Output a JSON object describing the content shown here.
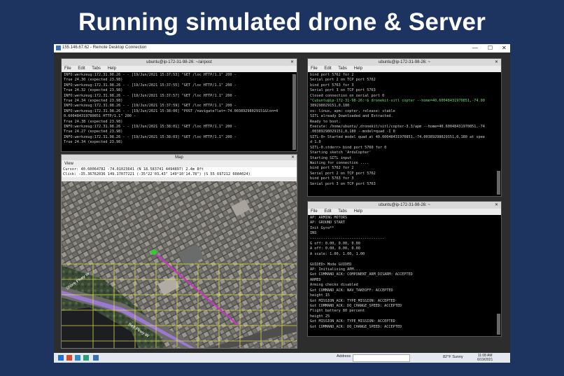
{
  "slide_title": "Running simulated drone & Server",
  "rdp": {
    "title": "155.146.67.62 - Remote Desktop Connection",
    "controls": [
      "—",
      "☐",
      "✕"
    ]
  },
  "term1": {
    "title": "ubuntu@ip-172-31-98-26: ~/airpost",
    "menu": [
      "File",
      "Edit",
      "Tabs",
      "Help"
    ],
    "lines": [
      "INFO:werkzeug:172.31.98.26 - - [19/Jun/2021 15:37:53] \"GET /loc HTTP/1.1\" 200 -",
      "True 24.30 (expected 23.98)",
      "INFO:werkzeug:172.31.98.26 - - [19/Jun/2021 15:37:55] \"GET /loc HTTP/1.1\" 200 -",
      "True 24.32 (expected 23.98)",
      "INFO:werkzeug:172.31.98.26 - - [19/Jun/2021 15:37:57] \"GET /loc HTTP/1.1\" 200 -",
      "True 24.34 (expected 23.98)",
      "INFO:werkzeug:172.31.98.26 - - [19/Jun/2021 15:37:59] \"GET /loc HTTP/1.1\" 200 -",
      "INFO:werkzeug:172.31.98.26 - - [19/Jun/2021 15:38:00] \"POST /navigate?lat=-74.00389298029151&lon=4",
      "0.600484319780851 HTTP/1.1\" 200 -",
      "True 24.38 (expected 23.98)",
      "INFO:werkzeug:172.31.98.26 - - [19/Jun/2021 15:38:01] \"GET /loc HTTP/1.1\" 200 -",
      "True 24.27 (expected 23.98)",
      "INFO:werkzeug:172.31.98.26 - - [19/Jun/2021 15:38:03] \"GET /loc HTTP/1.1\" 200 -",
      "True 24.34 (expected 23.98)"
    ]
  },
  "term2": {
    "title": "ubuntu@ip-172-31-98-26: ~",
    "menu": [
      "File",
      "Edit",
      "Tabs",
      "Help"
    ],
    "lines": [
      "bind port 5762 for 2",
      "Serial port 2 on TCP port 5762",
      "bind port 5763 for 3",
      "Serial port 3 on TCP port 5763",
      "Closed connection on serial port 0",
      "^Cubuntu@ip-172-31-98-26:~$ dronekit-sitl copter --home=40.60048431970851,-74.00",
      "389298029151,0,180",
      "os: linux, apm: copter, release: stable",
      "SITL already Downloaded and Extracted.",
      "Ready to boot.",
      "Execute: /home/ubuntu/.dronekit/sitl/copter-3.3/apm --home=40.60048431970851,-74",
      ".00389298029151,0,180 --model=quad -I 0",
      "SITL-0> Started model quad at 40.60048431970851,-74.00389298029151,0,180 at spee",
      "d 1.0",
      "SITL-0.stderr> bind port 5760 for 0",
      "Starting sketch 'ArduCopter'",
      "Starting SITL input",
      "Waiting for connection ....",
      "bind port 5762 for 2",
      "Serial port 2 on TCP port 5762",
      "bind port 5763 for 3",
      "Serial port 3 on TCP port 5763"
    ]
  },
  "term3": {
    "title": "ubuntu@ip-172-31-98-26: ~",
    "menu": [
      "File",
      "Edit",
      "Tabs",
      "Help"
    ],
    "lines": [
      "AP: ARMING MOTORS",
      "AP: GROUND START",
      "Init Gyro**",
      "INS",
      "----------------------------------",
      "G off: 0.00, 0.00, 0.00",
      "A off: 0.00, 0.00, 0.00",
      "A scale: 1.00, 1.00, 1.00",
      "",
      "GUIDED> Mode GUIDED",
      "AP: Initialising APM...",
      "Got COMMAND_ACK: COMPONENT_ARM_DISARM: ACCEPTED",
      "ARMED",
      "Arming checks disabled",
      "Got COMMAND_ACK: NAV_TAKEOFF: ACCEPTED",
      "height 15",
      "Got MISSION_ACK: TYPE_MISSION: ACCEPTED",
      "Got COMMAND_ACK: DO_CHANGE_SPEED: ACCEPTED",
      "Flight battery 80 percent",
      "height 25",
      "Got MISSION_ACK: TYPE_MISSION: ACCEPTED",
      "Got COMMAND_ACK: DO_CHANGE_SPEED: ACCEPTED"
    ]
  },
  "map": {
    "title": "Map",
    "view_menu": "View",
    "cursor": "Cursor: 40.60064782 -74.01023641 (N 18.583741 4494897) 2.4m 8ft",
    "click": "Click: -35.36762036 149.17077221 (-35°22'03.43\" 149°10'14.78\") (S 55 697212 6084024)",
    "labels": [
      "Shore Pkwy W",
      "Belt Pkwy W"
    ],
    "colors": {
      "route": "#cc33cc",
      "grid": "#e8e84a",
      "drone": "#33cc33"
    }
  },
  "taskbar": {
    "address_label": "Address",
    "weather": "82°F  Sunny",
    "time": "11:08 AM",
    "date": "6/19/2021"
  }
}
